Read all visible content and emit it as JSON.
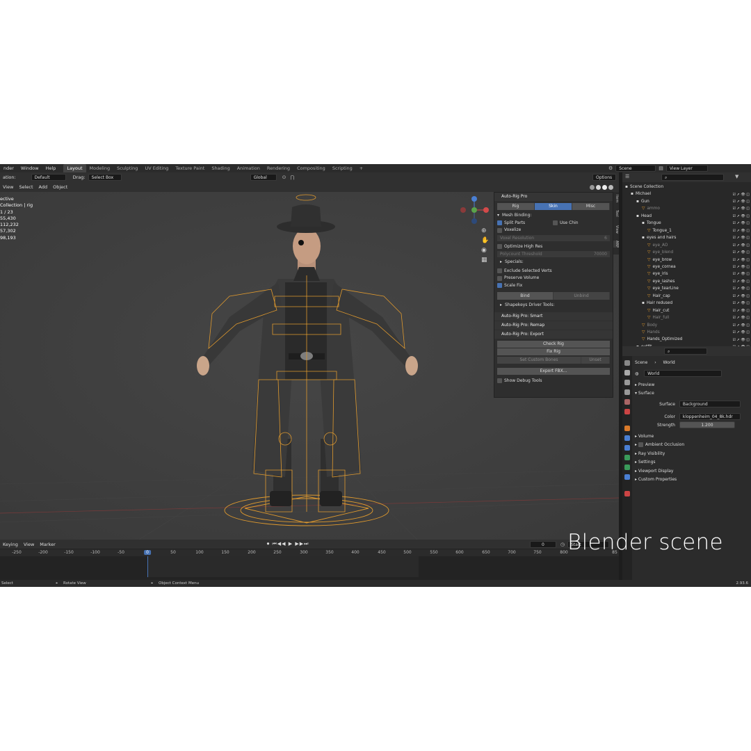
{
  "topbar": {
    "menu": [
      "nder",
      "Window",
      "Help"
    ],
    "tabs": [
      "Layout",
      "Modeling",
      "Sculpting",
      "UV Editing",
      "Texture Paint",
      "Shading",
      "Animation",
      "Rendering",
      "Compositing",
      "Scripting",
      "+"
    ],
    "active_tab": "Layout",
    "scene": "Scene",
    "view_layer": "View Layer"
  },
  "header2": {
    "orientation_label": "ation:",
    "orientation_value": "Default",
    "drag_label": "Drag:",
    "drag_value": "Select Box",
    "transform": "Global",
    "options": "Options"
  },
  "header3": {
    "menu": [
      "View",
      "Select",
      "Add",
      "Object"
    ]
  },
  "stats": [
    "ective",
    "Collection | rig",
    "",
    "1 / 23",
    "55,430",
    "112,232",
    "57,302",
    "98,193"
  ],
  "npanel": {
    "title": "Auto-Rig Pro",
    "tabs": [
      "Rig",
      "Skin",
      "Misc"
    ],
    "active_tab": "Skin",
    "mesh_binding": "Mesh Binding:",
    "split_parts": "Split Parts",
    "use_chin": "Use Chin",
    "voxelize": "Voxelize",
    "voxel_resolution_label": "Voxel Resolution",
    "voxel_resolution_value": "6",
    "optimize_high_res": "Optimize High Res",
    "polycount_label": "Polycount Threshold",
    "polycount_value": "70000",
    "specials": "Specials:",
    "exclude_selected": "Exclude Selected Verts",
    "preserve_volume": "Preserve Volume",
    "scale_fix": "Scale Fix",
    "bind": "Bind",
    "unbind": "Unbind",
    "shapekeys": "Shapekeys Driver Tools:",
    "smart": "Auto-Rig Pro: Smart",
    "remap": "Auto-Rig Pro: Remap",
    "export": "Auto-Rig Pro: Export",
    "check_rig": "Check Rig",
    "fix_rig": "Fix Rig",
    "set_custom_bones": "Set Custom Bones",
    "unset": "Unset",
    "export_fbx": "Export FBX...",
    "show_debug": "Show Debug Tools",
    "side_tabs": [
      "Item",
      "Tool",
      "View",
      "ARP"
    ]
  },
  "timeline": {
    "menu": [
      "Keying",
      "View",
      "Marker"
    ],
    "current_frame": "0",
    "start_label": "Start",
    "ticks": [
      "-250",
      "-200",
      "-150",
      "-100",
      "-50",
      "0",
      "50",
      "100",
      "150",
      "200",
      "250",
      "300",
      "350",
      "400",
      "450",
      "500",
      "550",
      "600",
      "650",
      "700",
      "750",
      "800",
      "85"
    ]
  },
  "statusbar": {
    "select": "Select",
    "rotate": "Rotate View",
    "context": "Object Context Menu",
    "version": "2.93.6"
  },
  "outliner": {
    "rows": [
      {
        "label": "Scene Collection",
        "indent": 0,
        "color": "#ddd"
      },
      {
        "label": "Michael",
        "indent": 1,
        "color": "#ddd"
      },
      {
        "label": "Gun",
        "indent": 2,
        "color": "#ddd"
      },
      {
        "label": "ammo",
        "indent": 3,
        "color": "#888"
      },
      {
        "label": "Head",
        "indent": 2,
        "color": "#ddd"
      },
      {
        "label": "Tongue",
        "indent": 3,
        "color": "#ddd"
      },
      {
        "label": "Tongue_1",
        "indent": 4,
        "color": "#ddd"
      },
      {
        "label": "eyes and hairs",
        "indent": 3,
        "color": "#ddd"
      },
      {
        "label": "eye_AO",
        "indent": 4,
        "color": "#888"
      },
      {
        "label": "eye_blend",
        "indent": 4,
        "color": "#888"
      },
      {
        "label": "eye_brow",
        "indent": 4,
        "color": "#ddd"
      },
      {
        "label": "eye_cornea",
        "indent": 4,
        "color": "#ddd"
      },
      {
        "label": "eye_iris",
        "indent": 4,
        "color": "#ddd"
      },
      {
        "label": "eye_lashes",
        "indent": 4,
        "color": "#ddd"
      },
      {
        "label": "eye_tearLine",
        "indent": 4,
        "color": "#ddd"
      },
      {
        "label": "Hair_cap",
        "indent": 4,
        "color": "#ddd"
      },
      {
        "label": "Hair redused",
        "indent": 3,
        "color": "#ddd"
      },
      {
        "label": "Hair_cut",
        "indent": 4,
        "color": "#ddd"
      },
      {
        "label": "Hair_full",
        "indent": 4,
        "color": "#888"
      },
      {
        "label": "Body",
        "indent": 3,
        "color": "#888"
      },
      {
        "label": "Hands",
        "indent": 3,
        "color": "#888"
      },
      {
        "label": "Hands_Optimized",
        "indent": 3,
        "color": "#ddd"
      },
      {
        "label": "outfit",
        "indent": 2,
        "color": "#ddd"
      }
    ]
  },
  "properties": {
    "scene": "Scene",
    "world": "World",
    "world_name": "World",
    "preview": "Preview",
    "surface": "Surface",
    "surface_label": "Surface",
    "surface_value": "Background",
    "color_label": "Color",
    "color_value": "kloppenheim_04_8k.hdr",
    "strength_label": "Strength",
    "strength_value": "1.200",
    "sections": [
      "Volume",
      "Ambient Occlusion",
      "Ray Visibility",
      "Settings",
      "Viewport Display",
      "Custom Properties"
    ]
  },
  "overlay": {
    "caption": "Blender scene"
  },
  "colors": {
    "accent": "#4772b3",
    "rig": "#e09a2e",
    "background": "#3d3d3d"
  }
}
